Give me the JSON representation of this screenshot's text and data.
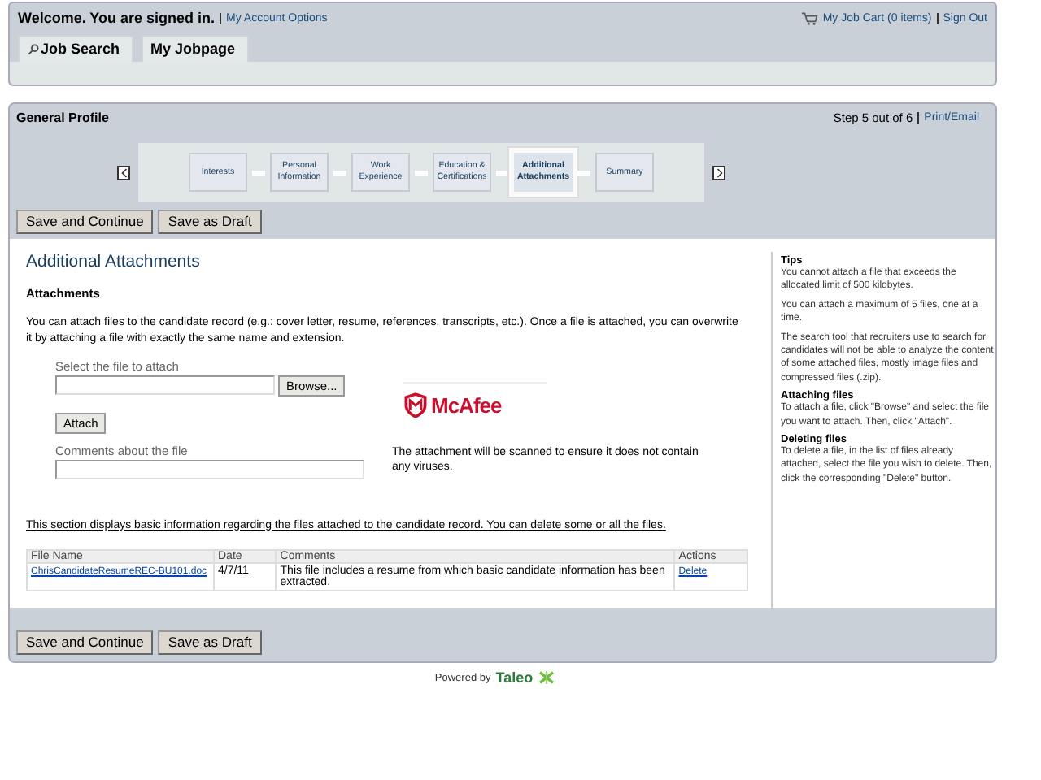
{
  "header": {
    "welcome": "Welcome. You are signed in.",
    "account_link": "My Account Options",
    "cart_link": "My Job Cart (0 items)",
    "sign_out": "Sign Out"
  },
  "tabs": [
    {
      "label": "Job Search",
      "selected": false,
      "kind": "search"
    },
    {
      "label": "My Jobpage",
      "selected": false,
      "kind": "plain"
    }
  ],
  "profile": {
    "title": "General Profile",
    "step_text": "Step 5 out of 6",
    "print_link": "Print/Email",
    "steps": [
      {
        "label": "Interests",
        "selected": false
      },
      {
        "label": "Personal Information",
        "selected": false
      },
      {
        "label": "Work Experience",
        "selected": false
      },
      {
        "label": "Education & Certifications",
        "selected": false
      },
      {
        "label": "Additional Attachments",
        "selected": true
      },
      {
        "label": "Summary",
        "selected": false
      }
    ],
    "buttons": [
      "Save and Continue",
      "Save as Draft"
    ]
  },
  "content": {
    "title": "Additional Attachments",
    "subtitle": "Attachments",
    "intro": "You can attach files to the candidate record (e.g.: cover letter, resume, references, transcripts, etc.). Once a file is attached, you can overwrite it by attaching a file with exactly the same name and extension.",
    "file_label": "Select the file to attach",
    "browse": "Browse...",
    "attach": "Attach",
    "comments_label": "Comments about the file",
    "logo": "McAfee",
    "scan_note": "The attachment will be scanned to ensure it does not contain any viruses.",
    "table_note": "This section displays basic information regarding the files attached to the candidate record. You can delete some or all the files.",
    "table": {
      "columns": [
        "File Name",
        "Date",
        "Comments",
        "Actions"
      ],
      "rows": [
        {
          "file": "ChrisCandidateResumeREC-BU101.doc",
          "date": "4/7/11",
          "comment": "This file includes a resume from which basic candidate information has been extracted.",
          "action": "Delete"
        }
      ]
    }
  },
  "tips": [
    {
      "heading": "Tips",
      "paragraphs": [
        "You cannot attach a file that exceeds the allocated limit of 500 kilobytes.",
        "You can attach a maximum of 5 files, one at a time.",
        "The search tool that recruiters use to search for candidates will not be able to analyze the content of some attached files, mostly image files and compressed files (.zip)."
      ]
    },
    {
      "heading": "Attaching files",
      "paragraphs": [
        "To attach a file, click \"Browse\" and select the file you want to attach. Then, click \"Attach\"."
      ]
    },
    {
      "heading": "Deleting files",
      "paragraphs": [
        "To delete a file, in the list of files already attached, select the file you wish to delete. Then, click the corresponding \"Delete\" button."
      ]
    }
  ],
  "bottom_buttons": [
    "Save and Continue",
    "Save as Draft"
  ],
  "footer": {
    "powered_by": "Powered by",
    "brand": "Taleo"
  }
}
